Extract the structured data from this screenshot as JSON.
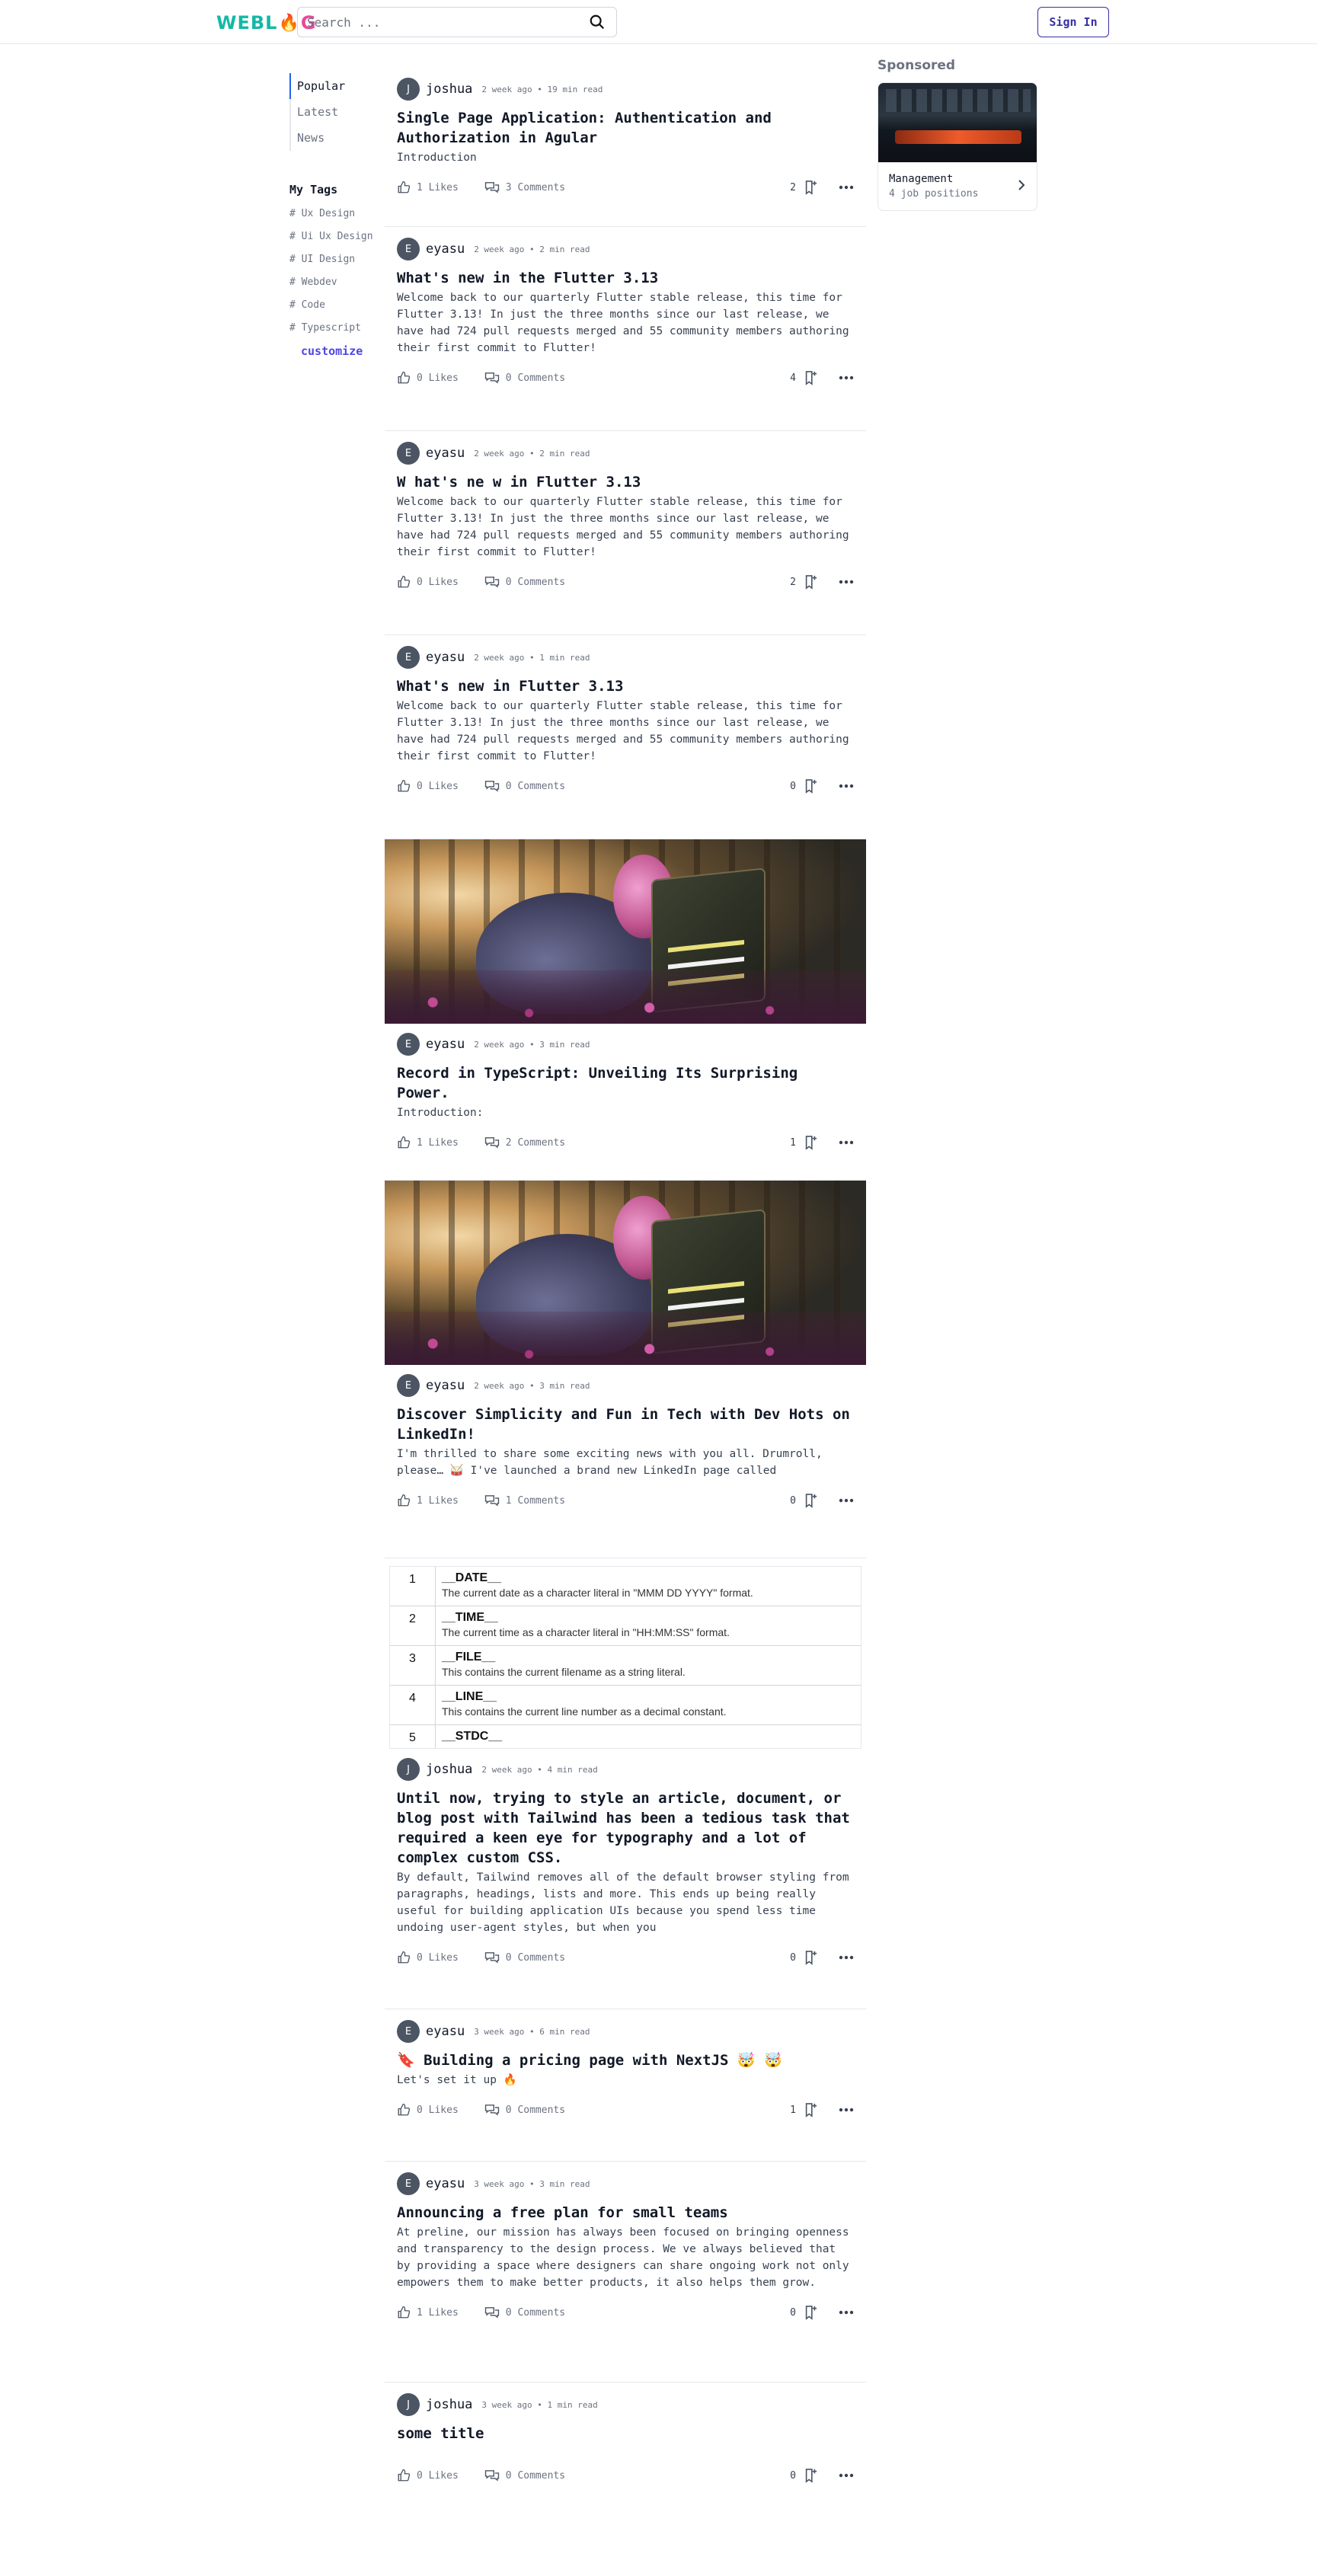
{
  "header": {
    "logo_text": "WEBLOG",
    "search_placeholder": "Search ...",
    "signin_label": "Sign In"
  },
  "nav": {
    "items": [
      {
        "label": "Popular",
        "active": true
      },
      {
        "label": "Latest",
        "active": false
      },
      {
        "label": "News",
        "active": false
      }
    ]
  },
  "tags": {
    "heading": "My Tags",
    "items": [
      "# Ux Design",
      "# Ui Ux Design",
      "# UI Design",
      "# Webdev",
      "# Code",
      "# Typescript"
    ],
    "customize_label": "customize"
  },
  "sponsored": {
    "heading": "Sponsored",
    "title": "Management",
    "subtitle": "4 job positions"
  },
  "posts": [
    {
      "avatar": "J",
      "author": "joshua",
      "date": "2 week ago • 19 min read",
      "title": "Single Page Application: Authentication and Authorization in Agular",
      "excerpt": "Introduction",
      "likes": "1 Likes",
      "comments": "3 Comments",
      "bookmarks": "2"
    },
    {
      "avatar": "E",
      "author": "eyasu",
      "date": "2 week ago • 2 min read",
      "title": "What's new in the Flutter 3.13",
      "excerpt": "Welcome back to our quarterly Flutter stable release, this time for Flutter 3.13! In just the three months since our last release, we have had 724 pull requests merged and 55 community members authoring their first commit to Flutter!",
      "likes": "0 Likes",
      "comments": "0 Comments",
      "bookmarks": "4"
    },
    {
      "avatar": "E",
      "author": "eyasu",
      "date": "2 week ago • 2 min read",
      "title": "W hat's ne w in Flutter 3.13",
      "excerpt": "Welcome back to our quarterly Flutter stable release, this time for Flutter 3.13! In just the three months since our last release, we have had 724 pull requests merged and 55 community members authoring their first commit to Flutter!",
      "likes": "0 Likes",
      "comments": "0 Comments",
      "bookmarks": "2"
    },
    {
      "avatar": "E",
      "author": "eyasu",
      "date": "2 week ago • 1 min read",
      "title": "What's new in Flutter 3.13",
      "excerpt": "Welcome back to our quarterly Flutter stable release, this time for Flutter 3.13! In just the three months since our last release, we have had 724 pull requests merged and 55 community members authoring their first commit to Flutter!",
      "likes": "0 Likes",
      "comments": "0 Comments",
      "bookmarks": "0"
    },
    {
      "avatar": "E",
      "author": "eyasu",
      "date": "2 week ago • 3 min read",
      "title": "Record in TypeScript: Unveiling Its Surprising Power.",
      "excerpt": "Introduction:",
      "likes": "1 Likes",
      "comments": "2 Comments",
      "bookmarks": "1"
    },
    {
      "avatar": "E",
      "author": "eyasu",
      "date": "2 week ago • 3 min read",
      "title": "Discover Simplicity and Fun in Tech with Dev Hots on LinkedIn!",
      "excerpt": "I'm thrilled to share some exciting news with you all. Drumroll, please… 🥁 I've launched a brand new LinkedIn page called",
      "likes": "1 Likes",
      "comments": "1 Comments",
      "bookmarks": "0"
    },
    {
      "avatar": "J",
      "author": "joshua",
      "date": "2 week ago • 4 min read",
      "title": "Until now, trying to style an article, document, or blog post with Tailwind has been a tedious task that required a keen eye for typography and a lot of complex custom CSS.",
      "excerpt": "By default, Tailwind removes all of the default browser styling from paragraphs, headings, lists and more. This ends up being really useful for building application UIs because you spend less time undoing user-agent styles, but when you",
      "likes": "0 Likes",
      "comments": "0 Comments",
      "bookmarks": "0"
    },
    {
      "avatar": "E",
      "author": "eyasu",
      "date": "3 week ago • 6 min read",
      "title": "🔖 Building a pricing page with NextJS 🤯 🤯",
      "excerpt": "Let's set it up 🔥",
      "likes": "0 Likes",
      "comments": "0 Comments",
      "bookmarks": "1"
    },
    {
      "avatar": "E",
      "author": "eyasu",
      "date": "3 week ago • 3 min read",
      "title": "Announcing a free plan for small teams",
      "excerpt": "At preline, our mission has always been focused on bringing openness and transparency to the design process. We ve always believed that by providing a space where designers can share ongoing work not only empowers them to make better products, it also helps them grow.",
      "likes": "1 Likes",
      "comments": "0 Comments",
      "bookmarks": "0"
    },
    {
      "avatar": "J",
      "author": "joshua",
      "date": "3 week ago • 1 min read",
      "title": "some title",
      "excerpt": "",
      "likes": "0 Likes",
      "comments": "0 Comments",
      "bookmarks": "0"
    }
  ],
  "table_cover": {
    "rows": [
      {
        "num": "1",
        "name": "__DATE__",
        "desc": "The current date as a character literal in \"MMM DD YYYY\" format."
      },
      {
        "num": "2",
        "name": "__TIME__",
        "desc": "The current time as a character literal in \"HH:MM:SS\" format."
      },
      {
        "num": "3",
        "name": "__FILE__",
        "desc": "This contains the current filename as a string literal."
      },
      {
        "num": "4",
        "name": "__LINE__",
        "desc": "This contains the current line number as a decimal constant."
      },
      {
        "num": "5",
        "name": "__STDC__",
        "desc": ""
      }
    ]
  }
}
